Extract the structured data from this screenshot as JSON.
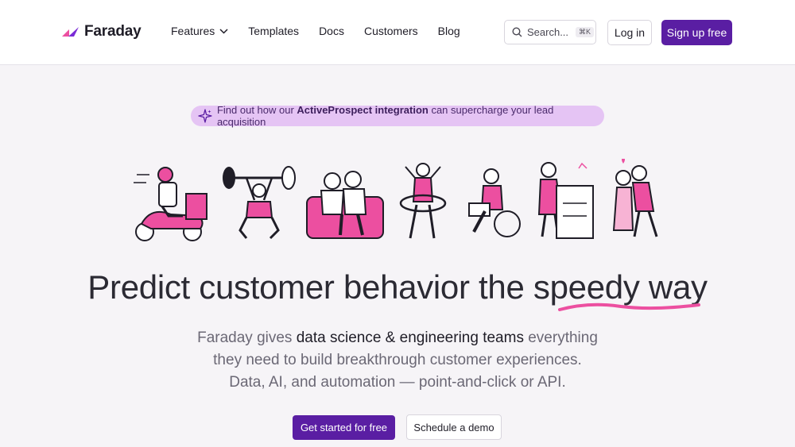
{
  "brand": {
    "name": "Faraday",
    "accent": "#5a1ea3",
    "pink": "#ec4fa0"
  },
  "nav": {
    "links": [
      {
        "label": "Features",
        "icon": "chevron-down-icon"
      },
      {
        "label": "Templates"
      },
      {
        "label": "Docs"
      },
      {
        "label": "Customers"
      },
      {
        "label": "Blog"
      }
    ],
    "search": {
      "placeholder": "Search...",
      "shortcut": "⌘K"
    },
    "login_label": "Log in",
    "signup_label": "Sign up free"
  },
  "announcement": {
    "prefix": "Find out how our ",
    "highlight": "ActiveProspect integration",
    "suffix": " can supercharge your lead acquisition",
    "icon": "sparkle-icon"
  },
  "hero": {
    "headline_before": "Predict customer behavior the ",
    "headline_emphasis": "speedy way",
    "sub_line1_before": "Faraday gives ",
    "sub_line1_bold": "data science & engineering teams",
    "sub_line1_after": " everything",
    "sub_line2": "they need to build breakthrough customer experiences.",
    "sub_line3": "Data, AI, and automation — point-and-click or API.",
    "cta_primary": "Get started for free",
    "cta_secondary": "Schedule a demo"
  }
}
